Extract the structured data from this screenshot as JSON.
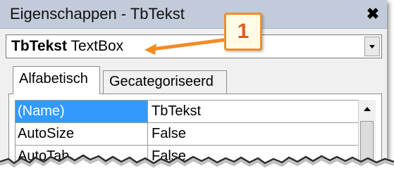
{
  "window": {
    "title": "Eigenschappen - TbTekst",
    "close_glyph": "✖"
  },
  "object_selector": {
    "name": "TbTekst",
    "type": "TextBox"
  },
  "tabs": [
    {
      "label": "Alfabetisch",
      "active": true
    },
    {
      "label": "Gecategoriseerd",
      "active": false
    }
  ],
  "properties": [
    {
      "name": "(Name)",
      "value": "TbTekst",
      "selected": true
    },
    {
      "name": "AutoSize",
      "value": "False",
      "selected": false
    },
    {
      "name": "AutoTab",
      "value": "False",
      "selected": false
    }
  ],
  "callout": {
    "number": "1",
    "color": "#f28c28"
  },
  "icons": {
    "close": "close-icon",
    "dropdown": "chevron-down-icon",
    "scroll_up": "chevron-up-icon"
  }
}
